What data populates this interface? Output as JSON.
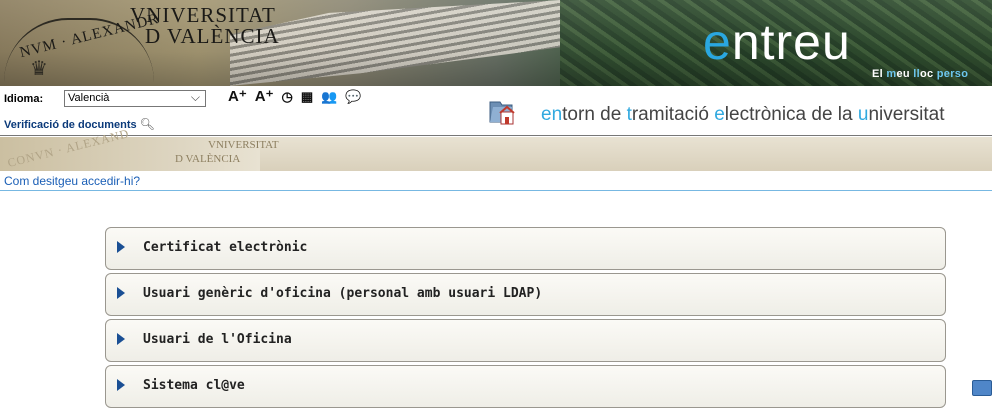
{
  "banner": {
    "univ_line1": "VNIVERSITAT",
    "univ_line2": "D VALÈNCIA",
    "seal_text": "NVM · ALEXANDR",
    "brand_first": "e",
    "brand_rest": "ntreu",
    "tagline": [
      "El ",
      "m",
      "eu ",
      "ll",
      "oc ",
      "perso"
    ]
  },
  "toolbar": {
    "language_label": "Idioma:",
    "language_value": "Valencià",
    "tools": [
      "A⁺",
      "A⁺",
      "◷",
      "▦",
      "👥",
      "💬"
    ],
    "verify_label": "Verificació de documents",
    "entorn_parts": [
      {
        "t": "en",
        "hl": true
      },
      {
        "t": "torn de ",
        "hl": false
      },
      {
        "t": "t",
        "hl": true
      },
      {
        "t": "ramitació ",
        "hl": false
      },
      {
        "t": "e",
        "hl": true
      },
      {
        "t": "lectrònica de la ",
        "hl": false
      },
      {
        "t": "u",
        "hl": true
      },
      {
        "t": "niversitat",
        "hl": false
      }
    ]
  },
  "ribbon": {
    "seal_text": "CONVN · ALEXAND",
    "univ_line1": "VNIVERSITAT",
    "univ_line2": "D VALÈNCIA"
  },
  "question": "Com desitgeu accedir-hi?",
  "options": [
    {
      "label": "Certificat electrònic"
    },
    {
      "label": "Usuari genèric d'oficina (personal amb usuari LDAP)"
    },
    {
      "label": "Usuari de l'Oficina"
    },
    {
      "label": "Sistema cl@ve"
    }
  ],
  "colors": {
    "accent": "#31a9df",
    "link": "#1b5fb6",
    "arrow": "#1a4f94"
  }
}
